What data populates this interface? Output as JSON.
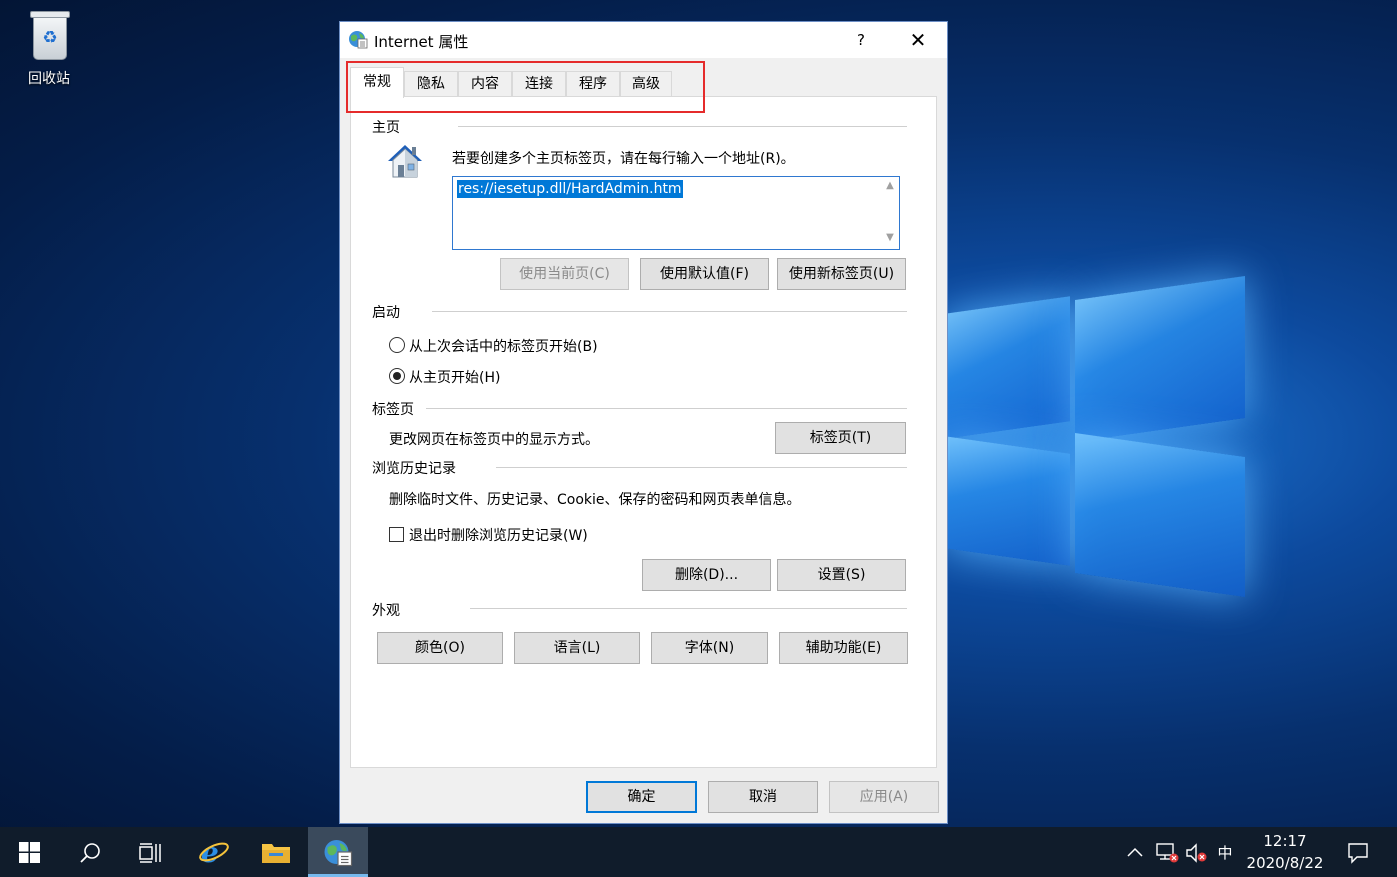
{
  "desktop": {
    "recycle_bin_label": "回收站"
  },
  "dialog": {
    "title": "Internet 属性",
    "help_label": "?",
    "close_label": "✕",
    "tabs": [
      {
        "label": "常规",
        "active": true
      },
      {
        "label": "隐私",
        "active": false
      },
      {
        "label": "内容",
        "active": false
      },
      {
        "label": "连接",
        "active": false
      },
      {
        "label": "程序",
        "active": false
      },
      {
        "label": "高级",
        "active": false
      }
    ],
    "home": {
      "section": "主页",
      "instruction": "若要创建多个主页标签页，请在每行输入一个地址(R)。",
      "url": "res://iesetup.dll/HardAdmin.htm",
      "btn_use_current": "使用当前页(C)",
      "btn_use_default": "使用默认值(F)",
      "btn_use_new_tab": "使用新标签页(U)"
    },
    "startup": {
      "section": "启动",
      "option_last_session": "从上次会话中的标签页开始(B)",
      "option_home": "从主页开始(H)",
      "selected": "option_home"
    },
    "tabs_section": {
      "section": "标签页",
      "description": "更改网页在标签页中的显示方式。",
      "btn_tabs": "标签页(T)"
    },
    "history": {
      "section": "浏览历史记录",
      "description": "删除临时文件、历史记录、Cookie、保存的密码和网页表单信息。",
      "checkbox_delete_on_exit": "退出时删除浏览历史记录(W)",
      "checkbox_checked": false,
      "btn_delete": "删除(D)...",
      "btn_settings": "设置(S)"
    },
    "appearance": {
      "section": "外观",
      "btn_colors": "颜色(O)",
      "btn_languages": "语言(L)",
      "btn_fonts": "字体(N)",
      "btn_accessibility": "辅助功能(E)"
    },
    "footer": {
      "btn_ok": "确定",
      "btn_cancel": "取消",
      "btn_apply": "应用(A)"
    }
  },
  "taskbar": {
    "ime": "中",
    "time": "12:17",
    "date": "2020/8/22"
  },
  "colors": {
    "accent": "#0078d7",
    "highlight_border": "#e52b2b",
    "taskbar": "#101c2b"
  }
}
